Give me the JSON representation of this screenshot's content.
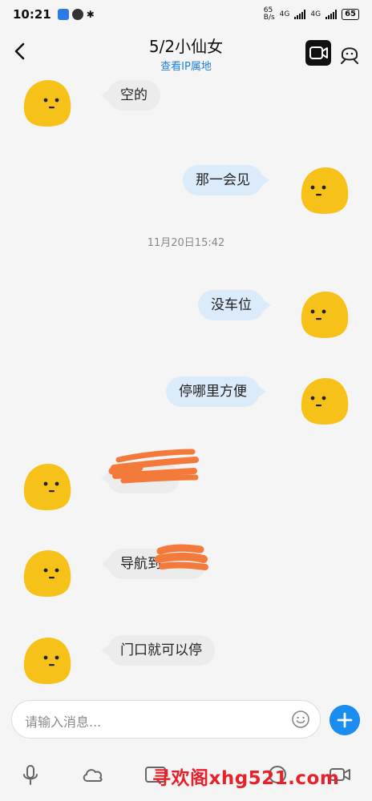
{
  "status_bar": {
    "time": "10:21",
    "net_speed_top": "65",
    "net_speed_unit": "B/s",
    "net1": "4G",
    "net2": "4G",
    "battery": "65"
  },
  "header": {
    "title": "5/2小仙女",
    "subtitle": "查看IP属地"
  },
  "messages": [
    {
      "side": "left",
      "text": "空的"
    },
    {
      "side": "right",
      "text": "那一会见"
    },
    {
      "side": "right",
      "text": "没车位"
    },
    {
      "side": "right",
      "text": "停哪里方便"
    },
    {
      "side": "left",
      "text": ""
    },
    {
      "side": "left",
      "text": "导航到"
    },
    {
      "side": "left",
      "text": "门口就可以停"
    }
  ],
  "timestamp": "11月20日15:42",
  "input": {
    "placeholder": "请输入消息..."
  },
  "watermark": "寻欢阁xhg521.com",
  "colors": {
    "accent": "#1b8cf0",
    "bubble_left": "#ececec",
    "bubble_right": "#dcebfa",
    "avatar_yellow": "#f6c21a",
    "redaction": "#f47a3c"
  },
  "icons": {
    "back": "chevron-left-icon",
    "video": "video-call-icon",
    "profile": "profile-icon",
    "emoji": "emoji-icon",
    "plus": "plus-icon",
    "mic": "microphone-icon",
    "cloud": "cloud-icon",
    "camera": "video-icon"
  }
}
